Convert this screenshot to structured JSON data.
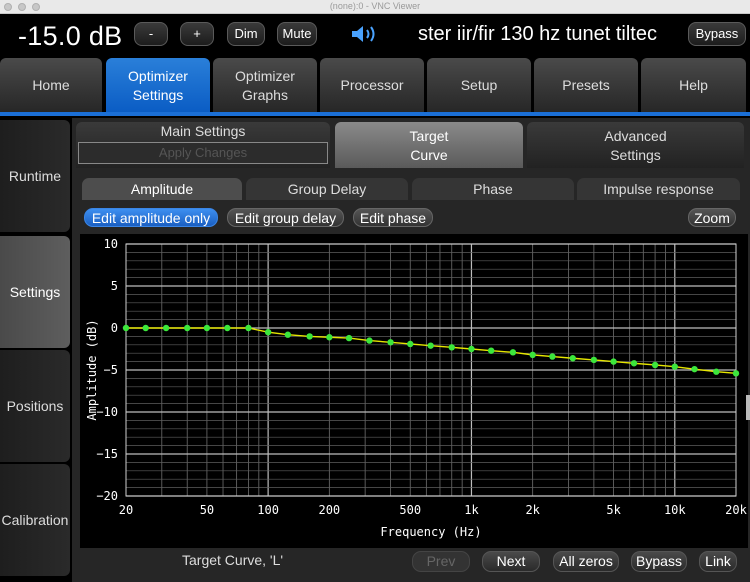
{
  "window": {
    "title": "(none):0 - VNC Viewer"
  },
  "topbar": {
    "volume": "-15.0 dB",
    "minus_label": "-",
    "plus_label": "+",
    "dim_label": "Dim",
    "mute_label": "Mute",
    "preset_name": "ster iir/fir 130 hz tunet tiltec",
    "bypass_label": "Bypass"
  },
  "main_nav": [
    {
      "line1": "Home",
      "line2": ""
    },
    {
      "line1": "Optimizer",
      "line2": "Settings"
    },
    {
      "line1": "Optimizer",
      "line2": "Graphs"
    },
    {
      "line1": "Processor",
      "line2": ""
    },
    {
      "line1": "Setup",
      "line2": ""
    },
    {
      "line1": "Presets",
      "line2": ""
    },
    {
      "line1": "Help",
      "line2": ""
    }
  ],
  "side_nav": [
    "Runtime",
    "Settings",
    "Positions",
    "Calibration"
  ],
  "sub_tabs": {
    "main_settings": "Main Settings",
    "apply_changes": "Apply Changes",
    "target_curve_1": "Target",
    "target_curve_2": "Curve",
    "advanced_1": "Advanced",
    "advanced_2": "Settings"
  },
  "chart_tabs": [
    "Amplitude",
    "Group Delay",
    "Phase",
    "Impulse response"
  ],
  "edit_pills": {
    "amplitude": "Edit amplitude only",
    "group_delay": "Edit group delay",
    "phase": "Edit phase",
    "zoom": "Zoom"
  },
  "chart_data": {
    "type": "line",
    "xlabel": "Frequency (Hz)",
    "ylabel": "Amplitude (dB)",
    "xscale": "log",
    "xlim": [
      20,
      20000
    ],
    "ylim": [
      -20,
      10
    ],
    "x_ticks": [
      20,
      50,
      100,
      200,
      500,
      1000,
      2000,
      5000,
      10000,
      20000
    ],
    "x_tick_labels": [
      "20",
      "50",
      "100",
      "200",
      "500",
      "1k",
      "2k",
      "5k",
      "10k",
      "20k"
    ],
    "y_ticks": [
      10,
      5,
      0,
      -5,
      -10,
      -15,
      -20
    ],
    "y_tick_labels": [
      "10",
      "5",
      "0",
      "−5",
      "−10",
      "−15",
      "−20"
    ],
    "grid": true,
    "line_color": "#e6e600",
    "point_color": "#3ce63c",
    "series": [
      {
        "x": [
          20,
          25,
          31.5,
          40,
          50,
          63,
          80,
          100,
          125,
          160,
          200,
          250,
          315,
          400,
          500,
          630,
          800,
          1000,
          1250,
          1600,
          2000,
          2500,
          3150,
          4000,
          5000,
          6300,
          8000,
          10000,
          12500,
          16000,
          20000
        ],
        "y": [
          0,
          0,
          0,
          0,
          0,
          0,
          0,
          -0.5,
          -0.8,
          -1.0,
          -1.1,
          -1.2,
          -1.5,
          -1.7,
          -1.9,
          -2.1,
          -2.3,
          -2.5,
          -2.7,
          -2.9,
          -3.2,
          -3.4,
          -3.6,
          -3.8,
          -4.0,
          -4.2,
          -4.4,
          -4.6,
          -4.9,
          -5.2,
          -5.4
        ]
      }
    ]
  },
  "bottom": {
    "label": "Target Curve, 'L'",
    "prev": "Prev",
    "next": "Next",
    "all_zeros": "All zeros",
    "bypass": "Bypass",
    "link": "Link"
  }
}
